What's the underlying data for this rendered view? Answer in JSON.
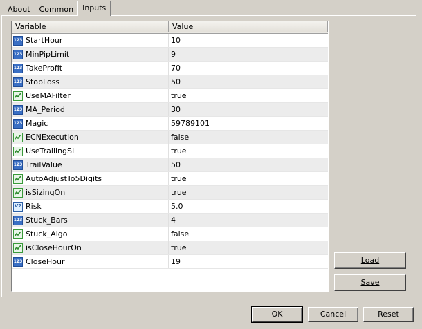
{
  "tabs": [
    {
      "label": "About"
    },
    {
      "label": "Common"
    },
    {
      "label": "Inputs"
    }
  ],
  "grid": {
    "headers": {
      "variable": "Variable",
      "value": "Value"
    },
    "rows": [
      {
        "name": "StartHour",
        "value": "10",
        "icon": "integer-icon"
      },
      {
        "name": "MinPipLimit",
        "value": "9",
        "icon": "integer-icon"
      },
      {
        "name": "TakeProfit",
        "value": "70",
        "icon": "integer-icon"
      },
      {
        "name": "StopLoss",
        "value": "50",
        "icon": "integer-icon"
      },
      {
        "name": "UseMAFilter",
        "value": "true",
        "icon": "boolean-icon"
      },
      {
        "name": "MA_Period",
        "value": "30",
        "icon": "integer-icon"
      },
      {
        "name": "Magic",
        "value": "59789101",
        "icon": "integer-icon"
      },
      {
        "name": "ECNExecution",
        "value": "false",
        "icon": "boolean-icon"
      },
      {
        "name": "UseTrailingSL",
        "value": "true",
        "icon": "boolean-icon"
      },
      {
        "name": "TrailValue",
        "value": "50",
        "icon": "integer-icon"
      },
      {
        "name": "AutoAdjustTo5Digits",
        "value": "true",
        "icon": "boolean-icon"
      },
      {
        "name": "isSizingOn",
        "value": "true",
        "icon": "boolean-icon"
      },
      {
        "name": "Risk",
        "value": "5.0",
        "icon": "double-icon"
      },
      {
        "name": "Stuck_Bars",
        "value": "4",
        "icon": "integer-icon"
      },
      {
        "name": "Stuck_Algo",
        "value": "false",
        "icon": "boolean-icon"
      },
      {
        "name": "isCloseHourOn",
        "value": "true",
        "icon": "boolean-icon"
      },
      {
        "name": "CloseHour",
        "value": "19",
        "icon": "integer-icon"
      }
    ]
  },
  "side_buttons": {
    "load": "Load",
    "save": "Save"
  },
  "footer_buttons": {
    "ok": "OK",
    "cancel": "Cancel",
    "reset": "Reset"
  }
}
